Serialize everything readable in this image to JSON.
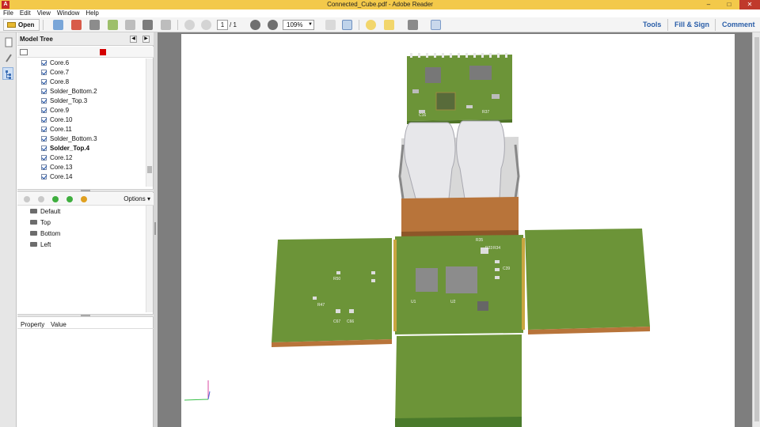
{
  "window": {
    "title": "Connected_Cube.pdf - Adobe Reader",
    "app_icon": "adobe-reader-icon",
    "minimize": "–",
    "maximize": "□",
    "close": "✕"
  },
  "menu": [
    "File",
    "Edit",
    "View",
    "Window",
    "Help"
  ],
  "toolbar": {
    "open_label": "Open",
    "page_current": "1",
    "page_total": "/ 1",
    "zoom_value": "109%",
    "tools_label": "Tools",
    "fill_sign_label": "Fill & Sign",
    "comment_label": "Comment"
  },
  "model_tree": {
    "title": "Model Tree",
    "items": [
      {
        "label": "Core.6",
        "bold": false
      },
      {
        "label": "Core.7",
        "bold": false
      },
      {
        "label": "Core.8",
        "bold": false
      },
      {
        "label": "Solder_Bottom.2",
        "bold": false
      },
      {
        "label": "Solder_Top.3",
        "bold": false
      },
      {
        "label": "Core.9",
        "bold": false
      },
      {
        "label": "Core.10",
        "bold": false
      },
      {
        "label": "Core.11",
        "bold": false
      },
      {
        "label": "Solder_Bottom.3",
        "bold": false
      },
      {
        "label": "Solder_Top.4",
        "bold": true
      },
      {
        "label": "Core.12",
        "bold": false
      },
      {
        "label": "Core.13",
        "bold": false
      },
      {
        "label": "Core.14",
        "bold": false
      }
    ]
  },
  "views": {
    "options_label": "Options ▾",
    "items": [
      "Default",
      "Top",
      "Bottom",
      "Left"
    ]
  },
  "properties": {
    "col_property": "Property",
    "col_value": "Value"
  },
  "board_labels": {
    "r_values": [
      "R50",
      "R47",
      "C67",
      "C66",
      "R35",
      "R33",
      "R34",
      "C39",
      "U1",
      "U2",
      "C16",
      "R37"
    ]
  },
  "colors": {
    "title_bar": "#f3c94a",
    "pcb_green": "#6c9438",
    "pcb_dark": "#4f7427",
    "flex_copper": "#b8743a",
    "link_blue": "#2a5ea8"
  }
}
